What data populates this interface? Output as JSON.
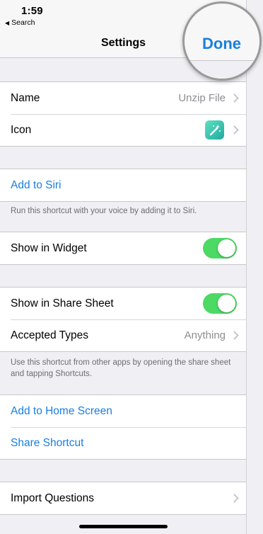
{
  "status": {
    "time": "1:59",
    "back_app": "Search"
  },
  "nav": {
    "title": "Settings",
    "done": "Done"
  },
  "rows": {
    "name": {
      "label": "Name",
      "value": "Unzip File"
    },
    "icon": {
      "label": "Icon"
    },
    "add_siri": {
      "label": "Add to Siri"
    },
    "siri_note": "Run this shortcut with your voice by adding it to Siri.",
    "widget": {
      "label": "Show in Widget",
      "on": true
    },
    "share_sheet": {
      "label": "Show in Share Sheet",
      "on": true
    },
    "accepted": {
      "label": "Accepted Types",
      "value": "Anything"
    },
    "share_note": "Use this shortcut from other apps by opening the share sheet and tapping Shortcuts.",
    "home_screen": {
      "label": "Add to Home Screen"
    },
    "share_shortcut": {
      "label": "Share Shortcut"
    },
    "import_questions": {
      "label": "Import Questions"
    }
  },
  "colors": {
    "accent": "#1a7fe0",
    "toggle_on": "#4cd964",
    "background": "#efeff4"
  },
  "icons": {
    "shortcut_icon": "magic-wand-icon",
    "back": "back-triangle-icon",
    "disclosure": "chevron-right-icon"
  }
}
